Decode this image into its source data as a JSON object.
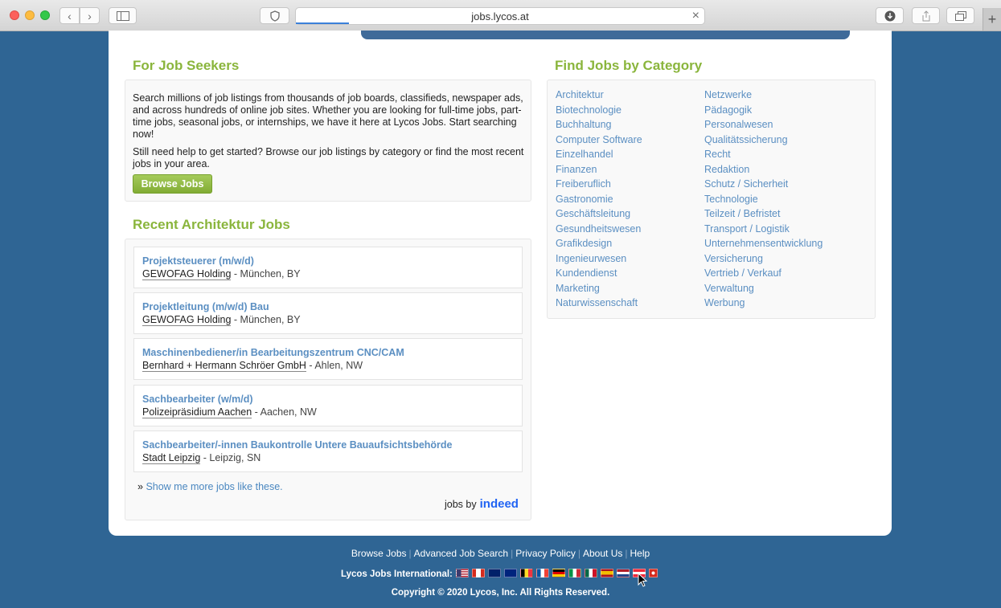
{
  "browser": {
    "url": "jobs.lycos.at",
    "shield_icon": "shield-icon",
    "close_icon": "close-icon"
  },
  "seekers": {
    "heading": "For Job Seekers",
    "para1": "Search millions of job listings from thousands of job boards, classifieds, newspaper ads, and across hundreds of online job sites. Whether you are looking for full-time jobs, part-time jobs, seasonal jobs, or internships, we have it here at Lycos Jobs. Start searching now!",
    "para2": "Still need help to get started? Browse our job listings by category or find the most recent jobs in your area.",
    "button": "Browse Jobs"
  },
  "recent": {
    "heading": "Recent Architektur Jobs",
    "jobs": [
      {
        "title": "Projektsteuerer (m/w/d)",
        "company": "GEWOFAG Holding",
        "location": " - München, BY"
      },
      {
        "title": "Projektleitung (m/w/d) Bau",
        "company": "GEWOFAG Holding",
        "location": " - München, BY"
      },
      {
        "title": "Maschinenbediener/in Bearbeitungszentrum CNC/CAM",
        "company": "Bernhard + Hermann Schröer GmbH",
        "location": " - Ahlen, NW"
      },
      {
        "title": "Sachbearbeiter (w/m/d)",
        "company": "Polizeipräsidium Aachen",
        "location": " - Aachen, NW"
      },
      {
        "title": "Sachbearbeiter/-innen Baukontrolle Untere Bauaufsichtsbehörde",
        "company": "Stadt Leipzig",
        "location": " - Leipzig, SN"
      }
    ],
    "more_prefix": "» ",
    "more_link": "Show me more jobs like these.",
    "jobs_by": "jobs by",
    "indeed": "indeed"
  },
  "categories": {
    "heading": "Find Jobs by Category",
    "col1": [
      "Architektur",
      "Biotechnologie",
      "Buchhaltung",
      "Computer Software",
      "Einzelhandel",
      "Finanzen",
      "Freiberuflich",
      "Gastronomie",
      "Geschäftsleitung",
      "Gesundheitswesen",
      "Grafikdesign",
      "Ingenieurwesen",
      "Kundendienst",
      "Marketing",
      "Naturwissenschaft"
    ],
    "col2": [
      "Netzwerke",
      "Pädagogik",
      "Personalwesen",
      "Qualitätssicherung",
      "Recht",
      "Redaktion",
      "Schutz / Sicherheit",
      "Technologie",
      "Teilzeit / Befristet",
      "Transport / Logistik",
      "Unternehmensentwicklung",
      "Versicherung",
      "Vertrieb / Verkauf",
      "Verwaltung",
      "Werbung"
    ]
  },
  "footer": {
    "links": [
      "Browse Jobs",
      "Advanced Job Search",
      "Privacy Policy",
      "About Us",
      "Help"
    ],
    "intl_label": "Lycos Jobs International:",
    "flags": [
      "us",
      "ca",
      "uk",
      "au",
      "be",
      "fr",
      "de",
      "it",
      "mx",
      "es",
      "nl",
      "at",
      "ch"
    ],
    "copyright": "Copyright © 2020 Lycos, Inc. All Rights Reserved."
  }
}
